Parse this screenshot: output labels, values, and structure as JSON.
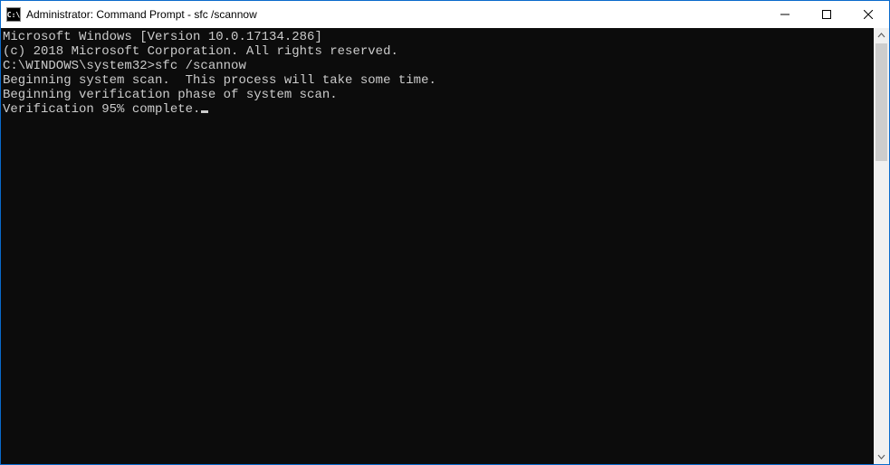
{
  "window": {
    "title": "Administrator: Command Prompt - sfc  /scannow",
    "icon_label": "C:\\"
  },
  "console": {
    "lines": [
      "Microsoft Windows [Version 10.0.17134.286]",
      "(c) 2018 Microsoft Corporation. All rights reserved.",
      "",
      "C:\\WINDOWS\\system32>sfc /scannow",
      "",
      "Beginning system scan.  This process will take some time.",
      "",
      "Beginning verification phase of system scan.",
      "Verification 95% complete."
    ]
  }
}
